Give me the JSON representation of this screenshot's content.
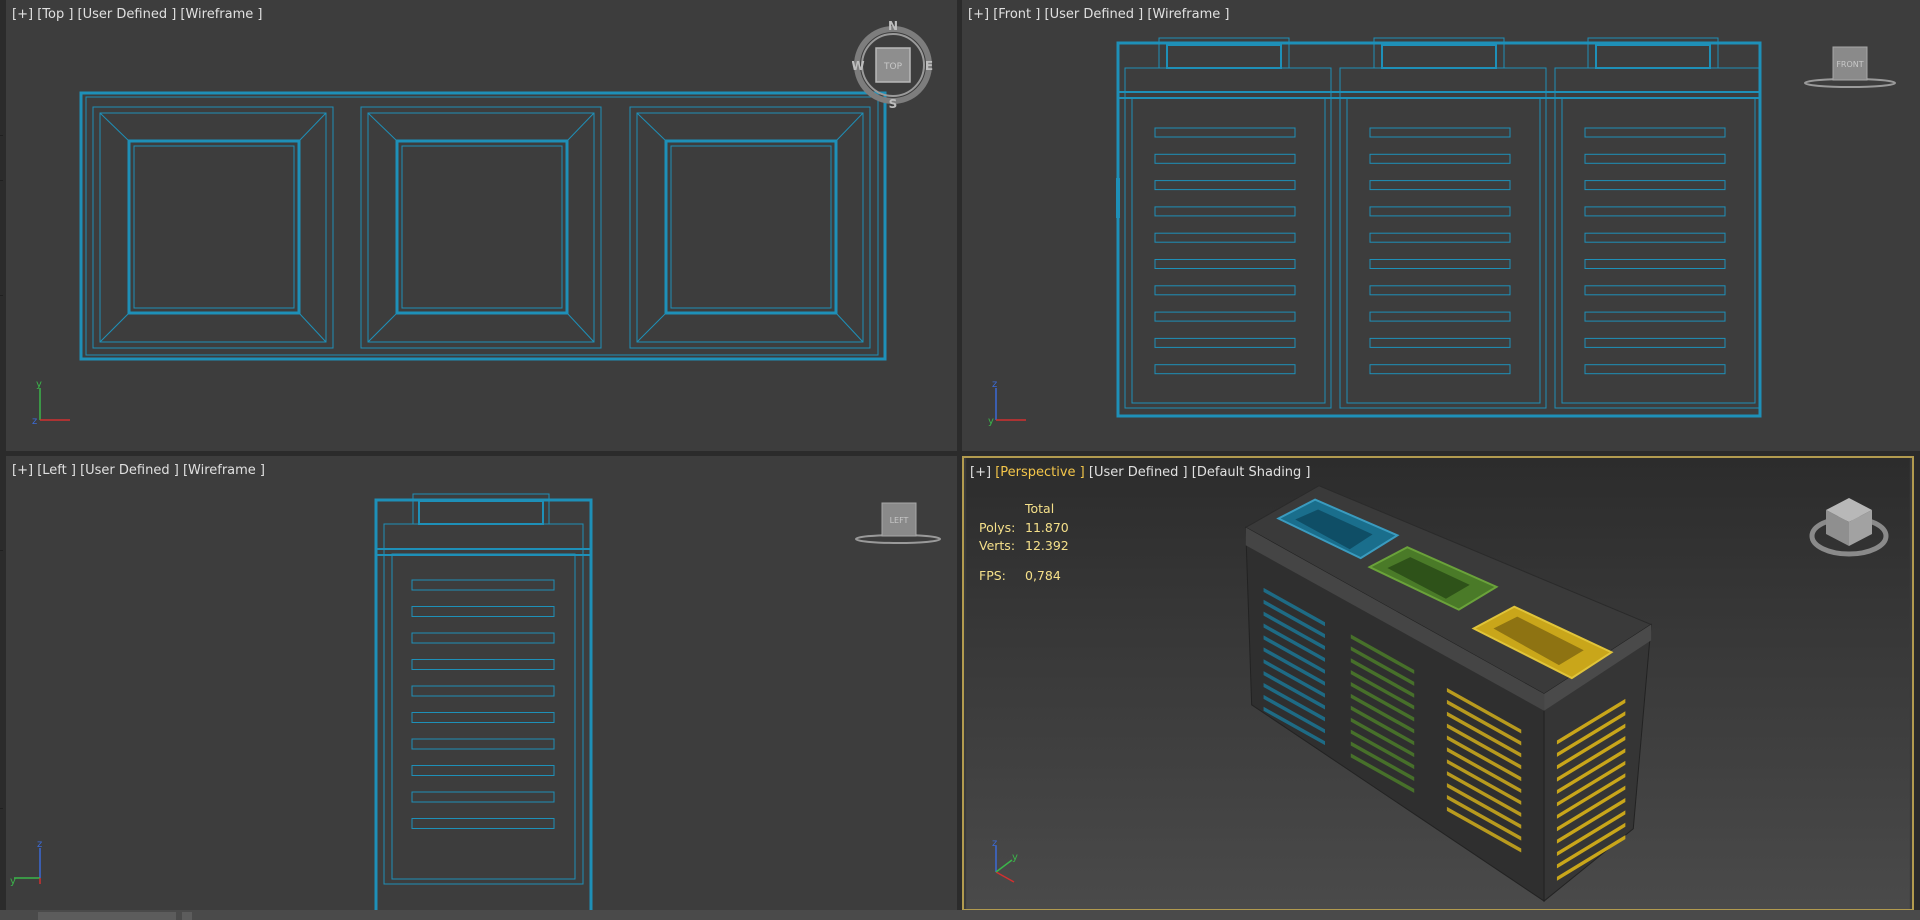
{
  "viewports": {
    "top": {
      "plus": "[+]",
      "view": "[Top ]",
      "mode": "[User Defined ]",
      "shading": "[Wireframe ]",
      "compass": {
        "n": "N",
        "s": "S",
        "e": "E",
        "w": "W",
        "cube": "TOP"
      }
    },
    "front": {
      "plus": "[+]",
      "view": "[Front ]",
      "mode": "[User Defined ]",
      "shading": "[Wireframe ]",
      "cube": "FRONT"
    },
    "left": {
      "plus": "[+]",
      "view": "[Left ]",
      "mode": "[User Defined ]",
      "shading": "[Wireframe ]",
      "cube": "LEFT"
    },
    "perspective": {
      "plus": "[+]",
      "view": "[Perspective ]",
      "mode": "[User Defined ]",
      "shading": "[Default Shading ]",
      "stats": {
        "header": "Total",
        "polys_label": "Polys:",
        "polys_value": "11.870",
        "verts_label": "Verts:",
        "verts_value": "12.392",
        "fps_label": "FPS:",
        "fps_value": "0,784"
      }
    }
  },
  "axes": {
    "x": "x",
    "y": "y",
    "z": "z"
  },
  "colors": {
    "wire": "#1e90b8",
    "bin_blue": "#1a6e8c",
    "bin_green": "#4a7a28",
    "bin_yellow": "#c9a61a",
    "active_border": "#b29b4f"
  }
}
